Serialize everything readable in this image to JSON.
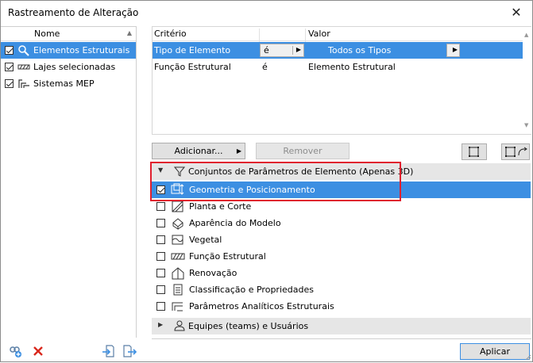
{
  "window": {
    "title": "Rastreamento de Alteração"
  },
  "left": {
    "header": {
      "name_col": "Nome"
    },
    "items": [
      {
        "label": "Elementos Estruturais",
        "checked": true,
        "selected": true,
        "icon": "magnifier-icon"
      },
      {
        "label": "Lajes selecionadas",
        "checked": true,
        "selected": false,
        "icon": "slab-hatch-icon"
      },
      {
        "label": "Sistemas MEP",
        "checked": true,
        "selected": false,
        "icon": "mep-icon"
      }
    ],
    "bottom_icons": [
      "add-set-icon",
      "delete-icon",
      "import-icon",
      "export-icon"
    ]
  },
  "criteria": {
    "headers": {
      "criterio": "Critério",
      "valor": "Valor"
    },
    "rows": [
      {
        "criterio": "Tipo de Elemento",
        "operator": "é",
        "valor": "Todos os Tipos",
        "selected": true
      },
      {
        "criterio": "Função Estrutural",
        "operator": "é",
        "valor": "Elemento Estrutural",
        "selected": false
      }
    ]
  },
  "buttons": {
    "adicionar": "Adicionar...",
    "remover": "Remover",
    "aplicar": "Aplicar"
  },
  "sections": {
    "param_sets": {
      "label": "Conjuntos de Parâmetros de Elemento (Apenas 3D)",
      "expanded": true
    },
    "teams": {
      "label": "Equipes (teams) e Usuários",
      "expanded": false
    }
  },
  "options": [
    {
      "label": "Geometria e Posicionamento",
      "checked": true,
      "selected": true,
      "icon": "geometry-icon"
    },
    {
      "label": "Planta e Corte",
      "checked": false,
      "selected": false,
      "icon": "floor-plan-icon"
    },
    {
      "label": "Aparência do Modelo",
      "checked": false,
      "selected": false,
      "icon": "appearance-icon"
    },
    {
      "label": "Vegetal",
      "checked": false,
      "selected": false,
      "icon": "surface-icon"
    },
    {
      "label": "Função Estrutural",
      "checked": false,
      "selected": false,
      "icon": "structural-hatch-icon"
    },
    {
      "label": "Renovação",
      "checked": false,
      "selected": false,
      "icon": "renovation-icon"
    },
    {
      "label": "Classificação e Propriedades",
      "checked": false,
      "selected": false,
      "icon": "classification-icon"
    },
    {
      "label": "Parâmetros Analíticos Estruturais",
      "checked": false,
      "selected": false,
      "icon": "analytical-icon"
    }
  ],
  "colors": {
    "selection": "#3c8fe2",
    "highlight_frame": "#e0202e",
    "delete": "#d9281d"
  }
}
